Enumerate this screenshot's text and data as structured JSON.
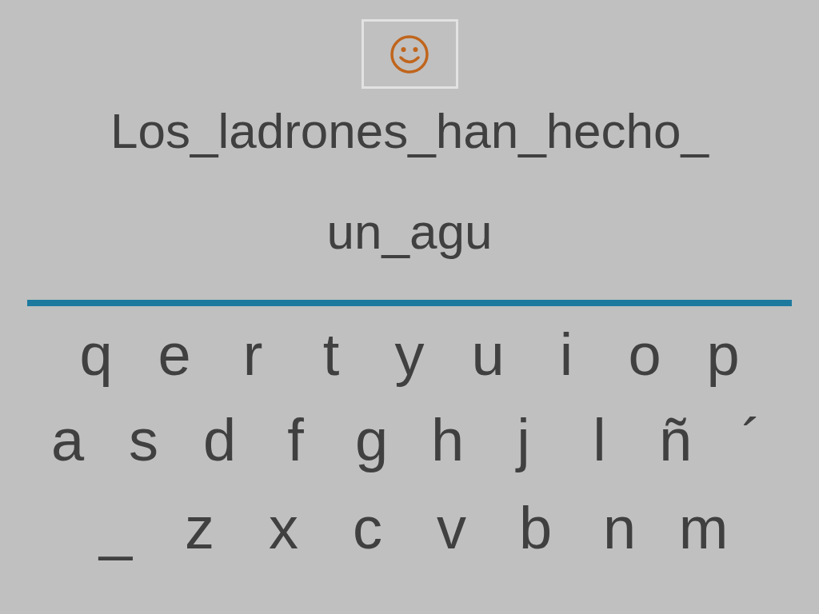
{
  "feedback": {
    "kind": "smiley"
  },
  "sentence": {
    "lines": [
      "Los_ladrones_han_hecho_",
      "un_agu"
    ]
  },
  "keyboard": {
    "rows": [
      [
        "q",
        "e",
        "r",
        "t",
        "y",
        "u",
        "i",
        "o",
        "p"
      ],
      [
        "a",
        "s",
        "d",
        "f",
        "g",
        "h",
        "j",
        "l",
        "ñ",
        "´"
      ],
      [
        "_",
        "z",
        "x",
        "c",
        "v",
        "b",
        "n",
        "m"
      ]
    ]
  }
}
